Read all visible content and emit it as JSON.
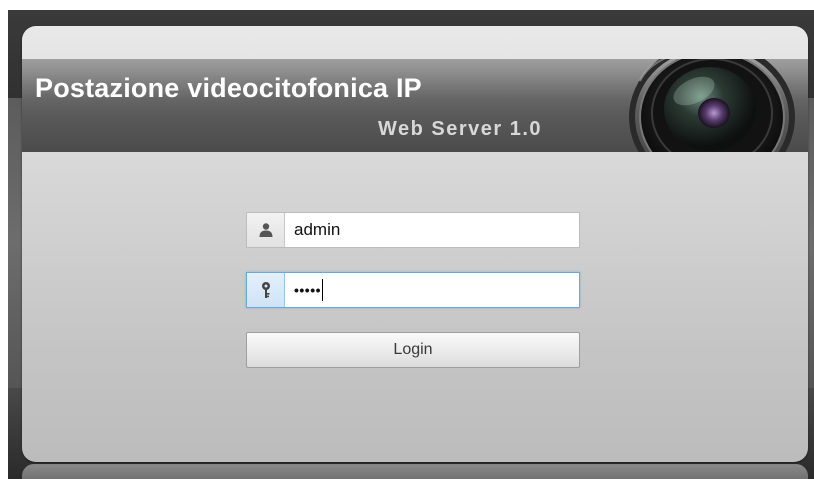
{
  "banner": {
    "title": "Postazione videocitofonica IP",
    "subtitle": "Web Server 1.0",
    "decoration_icon": "camera-lens-icon"
  },
  "login_form": {
    "username": {
      "icon": "user-icon",
      "value": "admin"
    },
    "password": {
      "icon": "key-icon",
      "masked_value": "•••••",
      "focused": true
    },
    "login_label": "Login"
  },
  "colors": {
    "banner_text": "#ffffff",
    "subtitle_text": "#d8d8d8",
    "focus_border": "#6aa8d8",
    "panel_bg": "#d6d6d6"
  }
}
